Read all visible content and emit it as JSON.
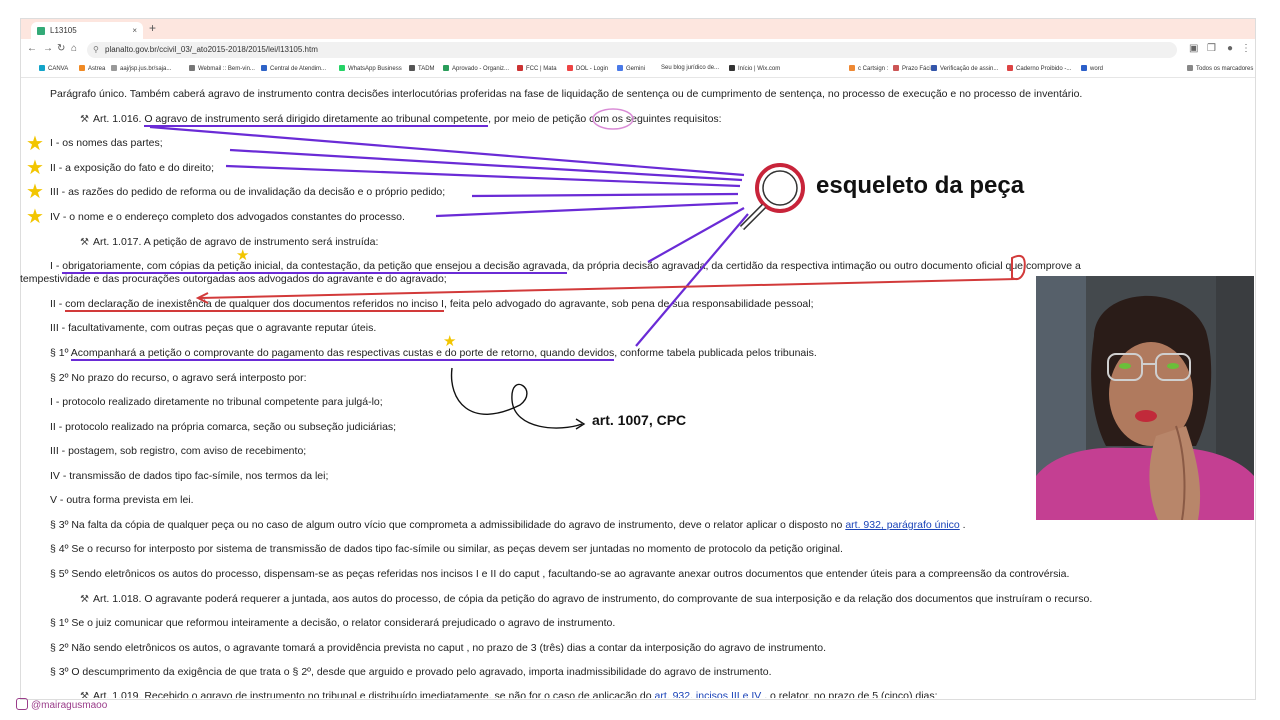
{
  "browser": {
    "tab_title": "L13105",
    "url": "planalto.gov.br/ccivil_03/_ato2015-2018/2015/lei/l13105.htm",
    "bookmarks": [
      "CANVA",
      "Astrea",
      "aaj/jsp.jus.br/saja...",
      "Webmail :: Bem-vin...",
      "Central de Atendim...",
      "WhatsApp Business",
      "TADM",
      "Aprovado - Organiz...",
      "FCC | Mata",
      "DOL - Login",
      "Gemini",
      "Seu blog jurídico de...",
      "Início | Wix.com",
      "c Cartsign :",
      "Prazo Fácil",
      "Verificação de assin...",
      "Caderno Proibido -...",
      "word",
      "Todos os marcadores"
    ]
  },
  "law": {
    "paragrafo_unico": "Parágrafo único. Também caberá agravo de instrumento contra decisões interlocutórias proferidas na fase de liquidação de sentença ou de cumprimento de sentença, no processo de execução e no processo de inventário.",
    "art1016_pre": "Art. 1.016. ",
    "art1016_ul": "O agravo de instrumento será dirigido diretamente ao tribunal competente",
    "art1016_mid": ", por meio de ",
    "art1016_word": "petição",
    "art1016_post": " com os seguintes requisitos:",
    "i1016": "I - os nomes das partes;",
    "ii1016": "II - a exposição do fato e do direito;",
    "iii1016": "III - as razões do pedido de reforma ou de invalidação da decisão e o próprio pedido;",
    "iv1016": "IV - o nome e o endereço completo dos advogados constantes do processo.",
    "art1017": "Art. 1.017. A petição de agravo de instrumento será instruída:",
    "i1017_pre": "I - ",
    "i1017_ul": "obrigatoriamente, com cópias da petição inicial, da contestação, da petição que ensejou a decisão agravada",
    "i1017_post": ", da própria decisão agravada, da certidão da respectiva intimação ou outro documento oficial que comprove a",
    "i1017_cont": "tempestividade e das procurações outorgadas aos advogados do agravante e do agravado;",
    "ii1017_pre": "II - ",
    "ii1017_ul": "com declaração de inexistência de qualquer dos documentos referidos no inciso I",
    "ii1017_post": ", feita pelo advogado do agravante, sob pena de sua responsabilidade pessoal;",
    "iii1017": "III - facultativamente, com outras peças que o agravante reputar úteis.",
    "p1_pre": "§ 1º ",
    "p1_ul": "Acompanhará a petição o comprovante do pagamento das respectivas custas e do porte de retorno, quando devidos",
    "p1_post": ", conforme tabela publicada pelos tribunais.",
    "p2": "§ 2º No prazo do recurso, o agravo será interposto por:",
    "l1": "I - protocolo realizado diretamente no tribunal competente para julgá-lo;",
    "l2": "II - protocolo realizado na própria comarca, seção ou subseção judiciárias;",
    "l3": "III - postagem, sob registro, com aviso de recebimento;",
    "l4": "IV - transmissão de dados tipo fac-símile, nos termos da lei;",
    "l5": "V - outra forma prevista em lei.",
    "p3_pre": "§ 3º Na falta da cópia de qualquer peça ou no caso de algum outro vício que comprometa a admissibilidade do agravo de instrumento, deve o relator aplicar o disposto no ",
    "p3_link": "art. 932, parágrafo único",
    "p3_post": " .",
    "p4": "§ 4º Se o recurso for interposto por sistema de transmissão de dados tipo fac-símile ou similar, as peças devem ser juntadas no momento de protocolo da petição original.",
    "p5": "§ 5º Sendo eletrônicos os autos do processo, dispensam-se as peças referidas nos incisos I e II do caput , facultando-se ao agravante anexar outros documentos que entender úteis para a compreensão da controvérsia.",
    "art1018": "Art. 1.018. O agravante poderá requerer a juntada, aos autos do processo, de cópia da petição do agravo de instrumento, do comprovante de sua interposição e da relação dos documentos que instruíram o recurso.",
    "s1_1018": "§ 1º Se o juiz comunicar que reformou inteiramente a decisão, o relator considerará prejudicado o agravo de instrumento.",
    "s2_1018": "§ 2º Não sendo eletrônicos os autos, o agravante tomará a providência prevista no caput , no prazo de 3 (três) dias a contar da interposição do agravo de instrumento.",
    "s3_1018": "§ 3º O descumprimento da exigência de que trata o § 2º, desde que arguido e provado pelo agravado, importa inadmissibilidade do agravo de instrumento.",
    "art1019_pre": "Art. 1.019. Recebido o agravo de instrumento no tribunal e distribuído imediatamente, se não for o caso de aplicação do ",
    "art1019_link": "art. 932, incisos III e IV",
    "art1019_post": " , o relator, no prazo de 5 (cinco) dias:"
  },
  "annotations": {
    "skeleton_label": "esqueleto da peça",
    "art_label": "art. 1007, CPC",
    "instagram": "@mairagusmaoo"
  },
  "colors": {
    "purple": "#6a2bd6",
    "red": "#d23a3a",
    "star": "#f2c500"
  },
  "icons": [
    "hammer-icon",
    "star-icon",
    "magnifier-icon",
    "instagram-icon"
  ]
}
